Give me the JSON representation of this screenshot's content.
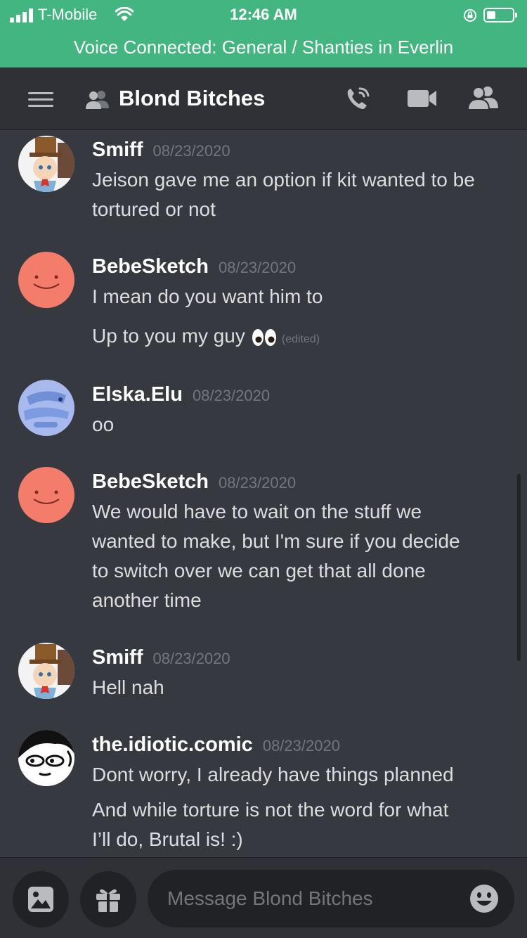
{
  "status_bar": {
    "carrier": "T-Mobile",
    "time": "12:46 AM"
  },
  "voice_banner": "Voice Connected: General / Shanties in Everlin",
  "header": {
    "title": "Blond Bitches"
  },
  "messages": [
    {
      "author": "Smiff",
      "timestamp": "08/23/2020",
      "lines": [
        "Jeison gave me an option if kit wanted to be",
        "tortured or not"
      ]
    },
    {
      "author": "BebeSketch",
      "timestamp": "08/23/2020",
      "lines": [
        "I mean do you want him to",
        "Up to you my guy"
      ],
      "edited_label": "(edited)"
    },
    {
      "author": "Elska.Elu",
      "timestamp": "08/23/2020",
      "lines": [
        "oo"
      ]
    },
    {
      "author": "BebeSketch",
      "timestamp": "08/23/2020",
      "lines": [
        "We would have to wait on the stuff we",
        "wanted to make, but I'm sure if you decide",
        "to switch over we can get that all done",
        "another time"
      ]
    },
    {
      "author": "Smiff",
      "timestamp": "08/23/2020",
      "lines": [
        "Hell nah"
      ]
    },
    {
      "author": "the.idiotic.comic",
      "timestamp": "08/23/2020",
      "lines": [
        "Dont worry, I already have things planned",
        "And while torture is not the word for what",
        "I’ll do, Brutal is! :)"
      ]
    }
  ],
  "composer": {
    "placeholder": "Message Blond Bitches"
  },
  "colors": {
    "voice_green": "#43b581",
    "background": "#36393f",
    "header_bg": "#2f3136",
    "avatar_salmon": "#f47c6b"
  },
  "icons": [
    "hamburger-icon",
    "dm-users-icon",
    "call-icon",
    "video-icon",
    "members-icon",
    "image-icon",
    "gift-icon",
    "emoji-icon",
    "eyes-emoji"
  ]
}
